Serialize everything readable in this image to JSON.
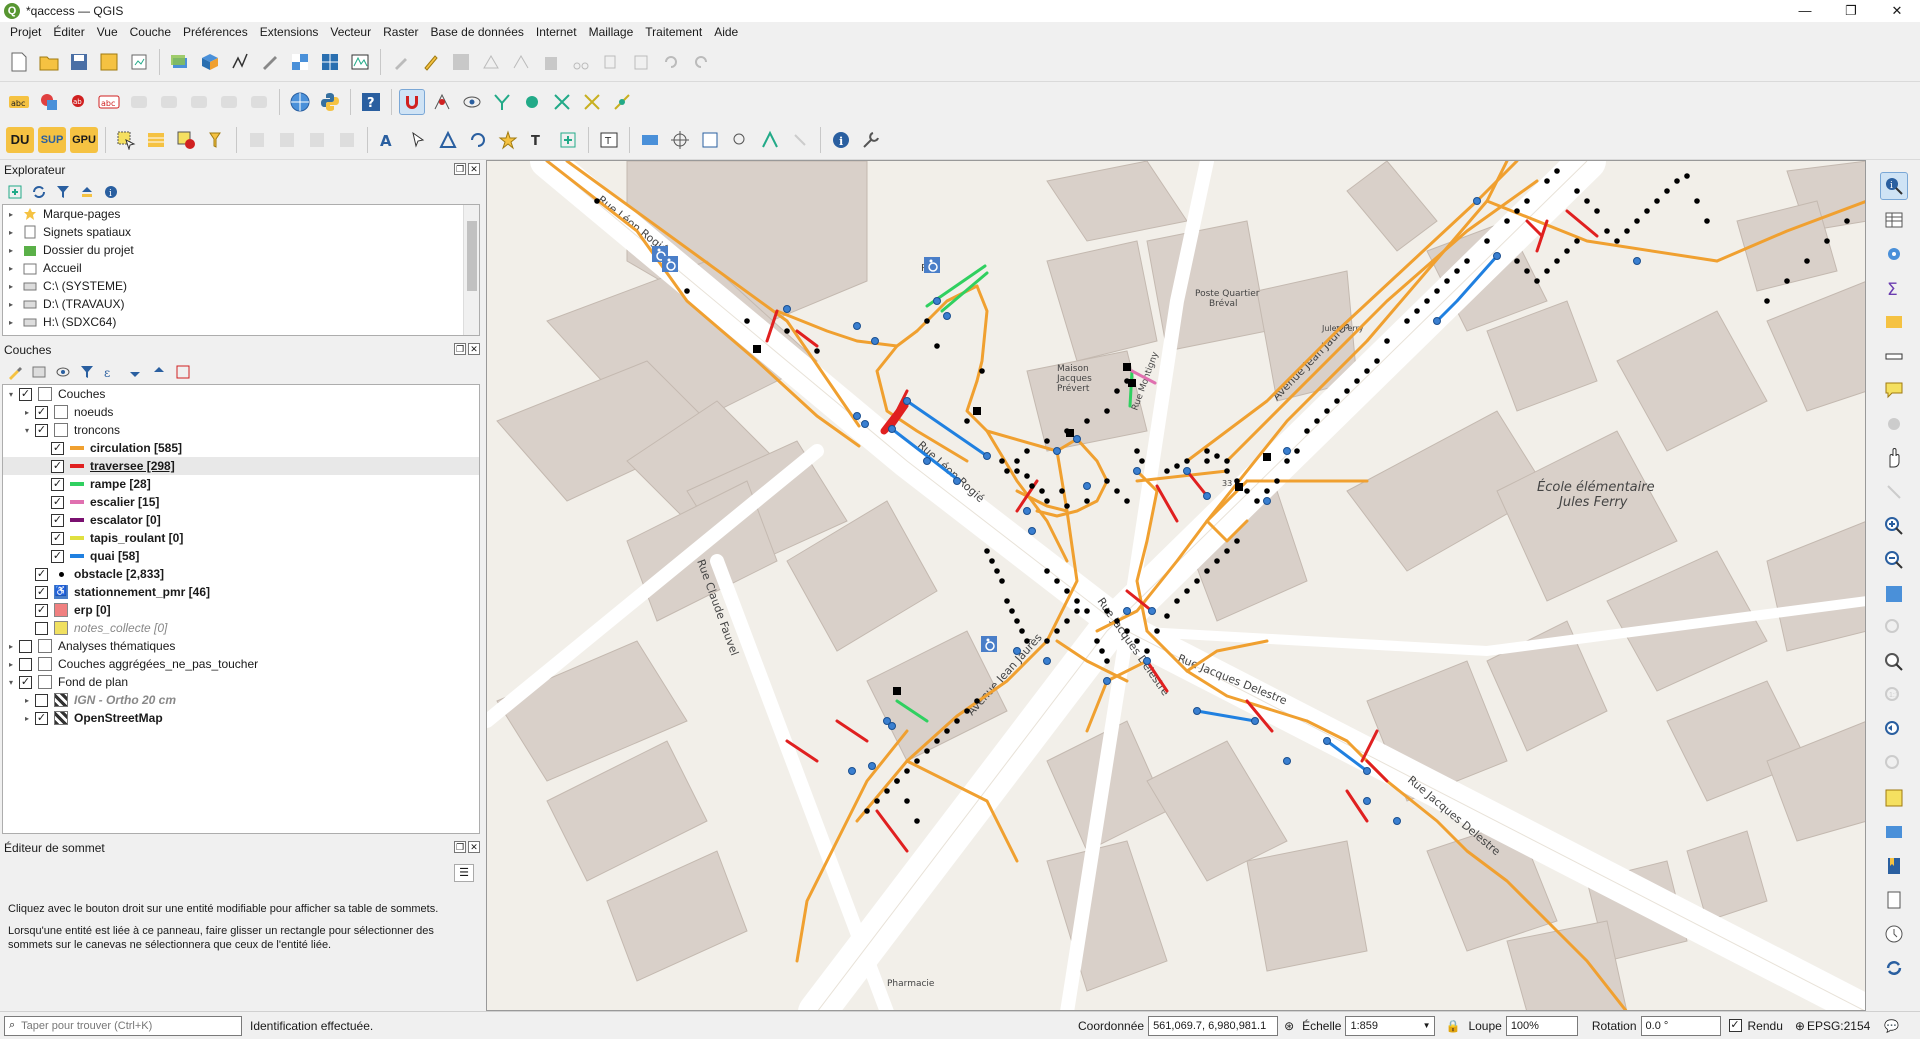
{
  "window": {
    "title": "*qaccess — QGIS",
    "controls": [
      "—",
      "❐",
      "✕"
    ]
  },
  "menu": [
    "Projet",
    "Éditer",
    "Vue",
    "Couche",
    "Préférences",
    "Extensions",
    "Vecteur",
    "Raster",
    "Base de données",
    "Internet",
    "Maillage",
    "Traitement",
    "Aide"
  ],
  "toolbar3": {
    "du": "DU",
    "sup": "SUP",
    "gpu": "GPU"
  },
  "explorer": {
    "title": "Explorateur",
    "items": [
      {
        "label": "Marque-pages",
        "icon": "star-icon"
      },
      {
        "label": "Signets spatiaux",
        "icon": "bookmark-icon"
      },
      {
        "label": "Dossier du projet",
        "icon": "project-folder-icon"
      },
      {
        "label": "Accueil",
        "icon": "home-folder-icon"
      },
      {
        "label": "C:\\ (SYSTEME)",
        "icon": "drive-icon"
      },
      {
        "label": "D:\\ (TRAVAUX)",
        "icon": "drive-icon"
      },
      {
        "label": "H:\\ (SDXC64)",
        "icon": "drive-icon"
      }
    ]
  },
  "layers": {
    "title": "Couches",
    "tree": [
      {
        "label": "Couches",
        "level": 0,
        "checked": true,
        "expand": "▾",
        "style": "normal"
      },
      {
        "label": "noeuds",
        "level": 1,
        "checked": true,
        "expand": "▸",
        "style": "normal"
      },
      {
        "label": "troncons",
        "level": 1,
        "checked": true,
        "expand": "▾",
        "style": "normal"
      },
      {
        "label": "circulation [585]",
        "level": 2,
        "checked": true,
        "swatch": "#f0a030",
        "style": "bold"
      },
      {
        "label": "traversee [298]",
        "level": 2,
        "checked": true,
        "swatch": "#e02020",
        "style": "bold-underline"
      },
      {
        "label": "rampe [28]",
        "level": 2,
        "checked": true,
        "swatch": "#30d060",
        "style": "bold"
      },
      {
        "label": "escalier [15]",
        "level": 2,
        "checked": true,
        "swatch": "#e070b0",
        "style": "bold"
      },
      {
        "label": "escalator [0]",
        "level": 2,
        "checked": true,
        "swatch": "#7a1070",
        "style": "bold"
      },
      {
        "label": "tapis_roulant [0]",
        "level": 2,
        "checked": true,
        "swatch": "#e0e040",
        "style": "bold"
      },
      {
        "label": "quai [58]",
        "level": 2,
        "checked": true,
        "swatch": "#2080e0",
        "style": "bold"
      },
      {
        "label": "obstacle [2,833]",
        "level": 1,
        "checked": true,
        "swatch": "dot",
        "style": "bold"
      },
      {
        "label": "stationnement_pmr [46]",
        "level": 1,
        "checked": true,
        "swatch": "pmr",
        "style": "bold"
      },
      {
        "label": "erp [0]",
        "level": 1,
        "checked": true,
        "swatch": "#f08080",
        "style": "bold"
      },
      {
        "label": "notes_collecte [0]",
        "level": 1,
        "checked": false,
        "swatch": "#f0e060",
        "style": "italic"
      },
      {
        "label": "Analyses thématiques",
        "level": 0,
        "checked": false,
        "expand": "▸",
        "style": "normal"
      },
      {
        "label": "Couches aggrégées_ne_pas_toucher",
        "level": 0,
        "checked": false,
        "expand": "▸",
        "style": "normal"
      },
      {
        "label": "Fond de plan",
        "level": 0,
        "checked": true,
        "expand": "▾",
        "style": "normal"
      },
      {
        "label": "IGN - Ortho 20 cm",
        "level": 1,
        "checked": false,
        "expand": "▸",
        "style": "italic"
      },
      {
        "label": "OpenStreetMap",
        "level": 1,
        "checked": true,
        "expand": "▸",
        "style": "bold"
      }
    ]
  },
  "vertex_editor": {
    "title": "Éditeur de sommet",
    "text1": "Cliquez avec le bouton droit sur une entité modifiable pour afficher sa table de sommets.",
    "text2": "Lorsqu'une entité est liée à ce panneau, faire glisser un rectangle pour sélectionner des sommets sur le canevas ne sélectionnera que ceux de l'entité liée."
  },
  "map_labels": {
    "rue_leon_rogie_top": "Rue Léon Rogié",
    "rue_leon_rogie_mid": "Rue Léon Rogié",
    "rue_claude_fauvel": "Rue Claude Fauvel",
    "avenue_jean_jaures_bottom": "Avenue Jean Jaurès",
    "avenue_jean_jaures_top": "Avenue Jean Jaurès",
    "rue_jacques_delestre_a": "Rue Jacques Delestre",
    "rue_jacques_delestre_b": "Rue Jacques Delestre",
    "rue_jacques_delestre_c": "Rue Jacques Delestre",
    "ecole": "École élémentaire",
    "ecole2": "Jules Ferry",
    "maison": "Maison",
    "maison2": "Jacques",
    "maison3": "Prévert",
    "poste": "Poste Quartier",
    "poste2": "Bréval",
    "jules_ferry_small": "Jules Ferry",
    "pharmacie": "Pharmacie",
    "number_33": "33",
    "parking_p": "P",
    "rue_montigny": "Rue Montigny"
  },
  "status": {
    "search_placeholder": "Taper pour trouver (Ctrl+K)",
    "message": "Identification effectuée.",
    "coord_label": "Coordonnée",
    "coord_value": "561,069.7, 6,980,981.1",
    "scale_label": "Échelle",
    "scale_value": "1:859",
    "loupe_label": "Loupe",
    "loupe_value": "100%",
    "rotation_label": "Rotation",
    "rotation_value": "0.0 °",
    "render_label": "Rendu",
    "crs": "EPSG:2154"
  },
  "colors": {
    "circulation": "#f0a030",
    "traversee": "#e02020",
    "rampe": "#30d060",
    "escalier": "#e070b0",
    "quai": "#2080e0",
    "node": "#3a7fd0",
    "pmr": "#4a7ec8"
  }
}
